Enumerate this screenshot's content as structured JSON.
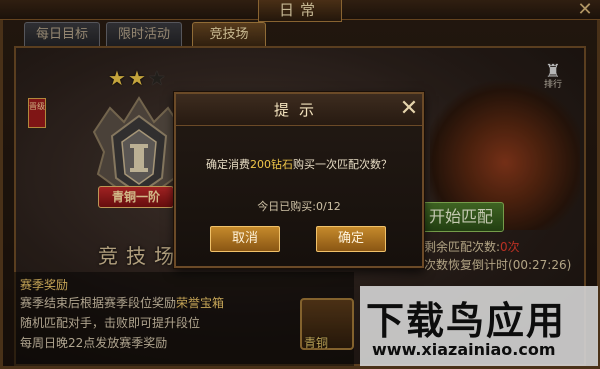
{
  "window": {
    "title": "日常"
  },
  "tabs": [
    {
      "label": "每日目标"
    },
    {
      "label": "限时活动"
    },
    {
      "label": "竞技场"
    }
  ],
  "arena": {
    "stars_filled": 2,
    "stars_total": 3,
    "rank_flag": "晋级",
    "rank_label": "青铜一阶",
    "title": "竞技场",
    "rank_button_label": "排行"
  },
  "match": {
    "start_button": "开始匹配",
    "count_label": "剩余匹配次数:",
    "count_value": "0次",
    "countdown_label": "次数恢复倒计时",
    "countdown_value": "(00:27:26)"
  },
  "season": {
    "title": "赛季奖励",
    "line1_prefix": "赛季结束后根据赛季段位奖励",
    "line1_highlight": "荣誉宝箱",
    "line2": "随机匹配对手，击败即可提升段位",
    "line3": "每周日晚22点发放赛季奖励",
    "chest_label": "青铜"
  },
  "dialog": {
    "title": "提示",
    "message_prefix": "确定消费",
    "message_highlight": "200钻石",
    "message_suffix": "购买一次匹配次数？",
    "purchased_text": "今日已购买:0/12",
    "cancel_label": "取消",
    "confirm_label": "确定"
  },
  "watermark": {
    "brand": "下载鸟应用",
    "url": "www.xiazainiao.com"
  },
  "colors": {
    "gold_highlight": "#f0c64a",
    "danger_red": "#e33b2b",
    "start_green": "#4d7a2b"
  }
}
